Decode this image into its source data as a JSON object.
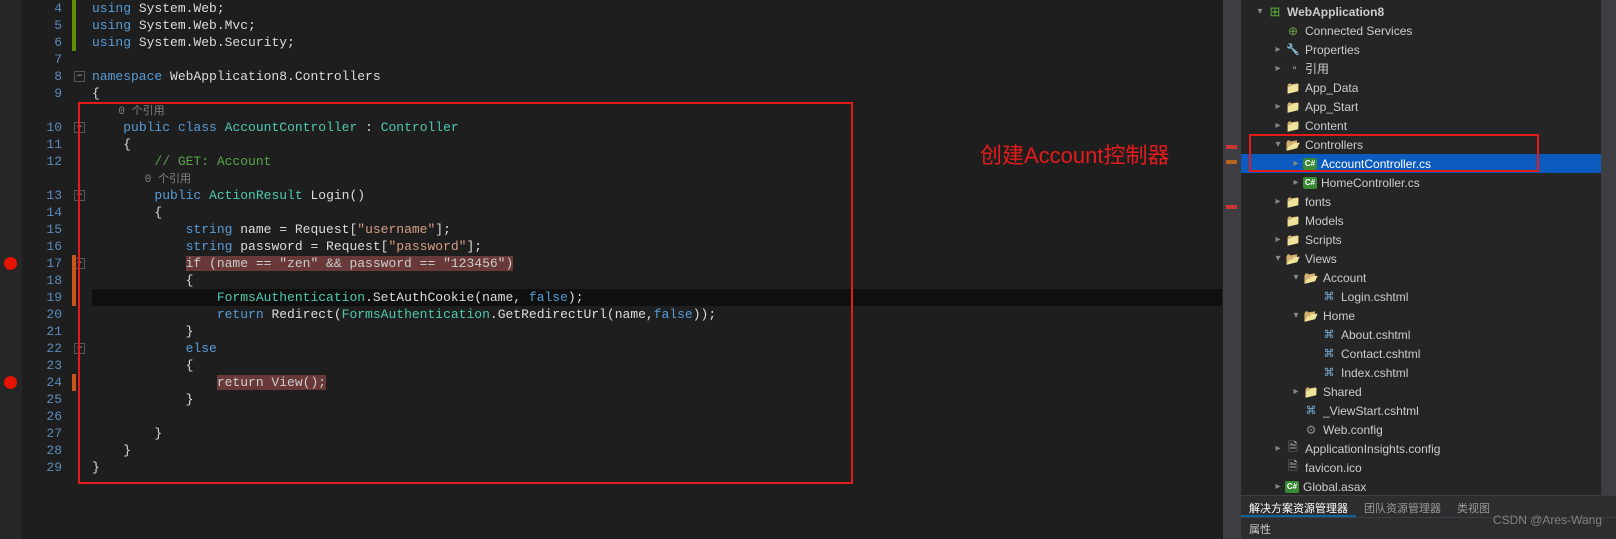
{
  "editor": {
    "lines": [
      {
        "n": 4,
        "tokens": [
          [
            "kw",
            "using"
          ],
          [
            "ident",
            " System.Web;"
          ]
        ]
      },
      {
        "n": 5,
        "tokens": [
          [
            "kw",
            "using"
          ],
          [
            "ident",
            " System.Web.Mvc;"
          ]
        ]
      },
      {
        "n": 6,
        "tokens": [
          [
            "kw",
            "using"
          ],
          [
            "ident",
            " System.Web.Security;"
          ]
        ]
      },
      {
        "n": 7,
        "tokens": [
          [
            "",
            ""
          ]
        ]
      },
      {
        "n": 8,
        "fold": true,
        "tokens": [
          [
            "kw",
            "namespace"
          ],
          [
            "ident",
            " WebApplication8.Controllers"
          ]
        ]
      },
      {
        "n": 9,
        "tokens": [
          [
            "ident",
            "{"
          ]
        ]
      },
      {
        "n": null,
        "lens": true,
        "tokens": [
          [
            "ref-lens",
            "    0 个引用"
          ]
        ]
      },
      {
        "n": 10,
        "fold": true,
        "tokens": [
          [
            "ident",
            "    "
          ],
          [
            "kw",
            "public class"
          ],
          [
            "ident",
            " "
          ],
          [
            "type",
            "AccountController"
          ],
          [
            "ident",
            " : "
          ],
          [
            "type",
            "Controller"
          ]
        ]
      },
      {
        "n": 11,
        "tokens": [
          [
            "ident",
            "    {"
          ]
        ]
      },
      {
        "n": 12,
        "tokens": [
          [
            "ident",
            "        "
          ],
          [
            "comment",
            "// GET: Account"
          ]
        ]
      },
      {
        "n": null,
        "lens": true,
        "tokens": [
          [
            "ref-lens",
            "        0 个引用"
          ]
        ]
      },
      {
        "n": 13,
        "fold": true,
        "tokens": [
          [
            "ident",
            "        "
          ],
          [
            "kw",
            "public"
          ],
          [
            "ident",
            " "
          ],
          [
            "type",
            "ActionResult"
          ],
          [
            "ident",
            " Login()"
          ]
        ]
      },
      {
        "n": 14,
        "tokens": [
          [
            "ident",
            "        {"
          ]
        ]
      },
      {
        "n": 15,
        "tokens": [
          [
            "ident",
            "            "
          ],
          [
            "kw",
            "string"
          ],
          [
            "ident",
            " name = Request["
          ],
          [
            "str",
            "\"username\""
          ],
          [
            "ident",
            "];"
          ]
        ]
      },
      {
        "n": 16,
        "tokens": [
          [
            "ident",
            "            "
          ],
          [
            "kw",
            "string"
          ],
          [
            "ident",
            " password = Request["
          ],
          [
            "str",
            "\"password\""
          ],
          [
            "ident",
            "];"
          ]
        ]
      },
      {
        "n": 17,
        "bp": true,
        "hl": true,
        "fold": true,
        "tokens": [
          [
            "ident",
            "            "
          ],
          [
            "hl-sel",
            "if (name == \"zen\" && password == \"123456\")"
          ]
        ]
      },
      {
        "n": 18,
        "tokens": [
          [
            "ident",
            "            {"
          ]
        ]
      },
      {
        "n": 19,
        "cur": true,
        "tokens": [
          [
            "ident",
            "                "
          ],
          [
            "type",
            "FormsAuthentication"
          ],
          [
            "ident",
            ".SetAuthCookie(name, "
          ],
          [
            "kw",
            "false"
          ],
          [
            "ident",
            ");"
          ]
        ]
      },
      {
        "n": 20,
        "tokens": [
          [
            "ident",
            "                "
          ],
          [
            "kw",
            "return"
          ],
          [
            "ident",
            " Redirect("
          ],
          [
            "type",
            "FormsAuthentication"
          ],
          [
            "ident",
            ".GetRedirectUrl(name,"
          ],
          [
            "kw",
            "false"
          ],
          [
            "ident",
            "));"
          ]
        ]
      },
      {
        "n": 21,
        "tokens": [
          [
            "ident",
            "            }"
          ]
        ]
      },
      {
        "n": 22,
        "fold": true,
        "tokens": [
          [
            "ident",
            "            "
          ],
          [
            "kw",
            "else"
          ]
        ]
      },
      {
        "n": 23,
        "tokens": [
          [
            "ident",
            "            {"
          ]
        ]
      },
      {
        "n": 24,
        "bp": true,
        "hl": true,
        "tokens": [
          [
            "ident",
            "                "
          ],
          [
            "hl-sel",
            "return View();"
          ]
        ]
      },
      {
        "n": 25,
        "tokens": [
          [
            "ident",
            "            }"
          ]
        ]
      },
      {
        "n": 26,
        "tokens": [
          [
            "",
            ""
          ]
        ]
      },
      {
        "n": 27,
        "tokens": [
          [
            "ident",
            "        }"
          ]
        ]
      },
      {
        "n": 28,
        "tokens": [
          [
            "ident",
            "    }"
          ]
        ]
      },
      {
        "n": 29,
        "tokens": [
          [
            "ident",
            "}"
          ]
        ]
      }
    ],
    "annotation": "创建Account控制器"
  },
  "tree": [
    {
      "d": 0,
      "exp": "▾",
      "icon": "proj",
      "label": "WebApplication8",
      "bold": true
    },
    {
      "d": 1,
      "exp": "",
      "icon": "conn",
      "label": "Connected Services"
    },
    {
      "d": 1,
      "exp": "▸",
      "icon": "wrench",
      "label": "Properties"
    },
    {
      "d": 1,
      "exp": "▸",
      "icon": "ref",
      "label": "引用"
    },
    {
      "d": 1,
      "exp": "",
      "icon": "folder",
      "label": "App_Data"
    },
    {
      "d": 1,
      "exp": "▸",
      "icon": "folder",
      "label": "App_Start"
    },
    {
      "d": 1,
      "exp": "▸",
      "icon": "folder",
      "label": "Content"
    },
    {
      "d": 1,
      "exp": "▾",
      "icon": "folderopen",
      "label": "Controllers"
    },
    {
      "d": 2,
      "exp": "▸",
      "icon": "cs",
      "label": "AccountController.cs",
      "sel": true
    },
    {
      "d": 2,
      "exp": "▸",
      "icon": "cs",
      "label": "HomeController.cs"
    },
    {
      "d": 1,
      "exp": "▸",
      "icon": "folder",
      "label": "fonts"
    },
    {
      "d": 1,
      "exp": "",
      "icon": "folder",
      "label": "Models"
    },
    {
      "d": 1,
      "exp": "▸",
      "icon": "folder",
      "label": "Scripts"
    },
    {
      "d": 1,
      "exp": "▾",
      "icon": "folderopen",
      "label": "Views"
    },
    {
      "d": 2,
      "exp": "▾",
      "icon": "folderopen",
      "label": "Account"
    },
    {
      "d": 3,
      "exp": "",
      "icon": "cshtml",
      "label": "Login.cshtml"
    },
    {
      "d": 2,
      "exp": "▾",
      "icon": "folderopen",
      "label": "Home"
    },
    {
      "d": 3,
      "exp": "",
      "icon": "cshtml",
      "label": "About.cshtml"
    },
    {
      "d": 3,
      "exp": "",
      "icon": "cshtml",
      "label": "Contact.cshtml"
    },
    {
      "d": 3,
      "exp": "",
      "icon": "cshtml",
      "label": "Index.cshtml"
    },
    {
      "d": 2,
      "exp": "▸",
      "icon": "folder",
      "label": "Shared"
    },
    {
      "d": 2,
      "exp": "",
      "icon": "cshtml",
      "label": "_ViewStart.cshtml"
    },
    {
      "d": 2,
      "exp": "",
      "icon": "config",
      "label": "Web.config"
    },
    {
      "d": 1,
      "exp": "▸",
      "icon": "file",
      "label": "ApplicationInsights.config"
    },
    {
      "d": 1,
      "exp": "",
      "icon": "file",
      "label": "favicon.ico"
    },
    {
      "d": 1,
      "exp": "▸",
      "icon": "cs",
      "label": "Global.asax"
    }
  ],
  "tabs": {
    "active": "解决方案资源管理器",
    "others": [
      "团队资源管理器",
      "类视图"
    ]
  },
  "props_title": "属性",
  "watermark": "CSDN @Ares-Wang"
}
